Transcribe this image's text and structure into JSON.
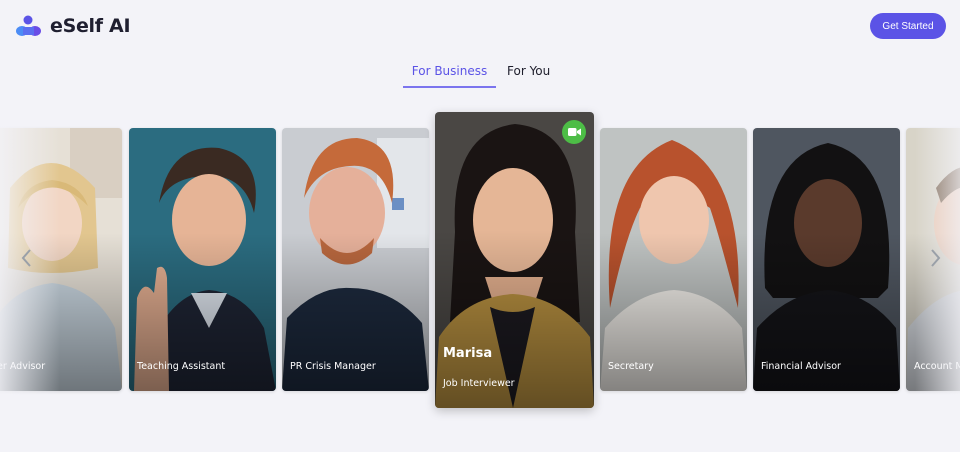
{
  "header": {
    "brand": "eSelf AI",
    "cta_label": "Get Started"
  },
  "tabs": [
    {
      "label": "For Business",
      "active": true
    },
    {
      "label": "For You",
      "active": false
    }
  ],
  "cards": [
    {
      "role": "...er Advisor"
    },
    {
      "role": "Teaching Assistant"
    },
    {
      "role": "PR Crisis Manager"
    },
    {
      "name": "Marisa",
      "role": "Job Interviewer",
      "featured": true
    },
    {
      "role": "Secretary"
    },
    {
      "role": "Financial Advisor"
    },
    {
      "role": "Account M..."
    }
  ],
  "icons": {
    "logo": "eself-logo-icon",
    "video": "video-camera-icon",
    "prev": "chevron-left-icon",
    "next": "chevron-right-icon"
  },
  "colors": {
    "accent": "#5b53e6",
    "video_badge": "#4dbd46",
    "background": "#f3f3f8"
  }
}
